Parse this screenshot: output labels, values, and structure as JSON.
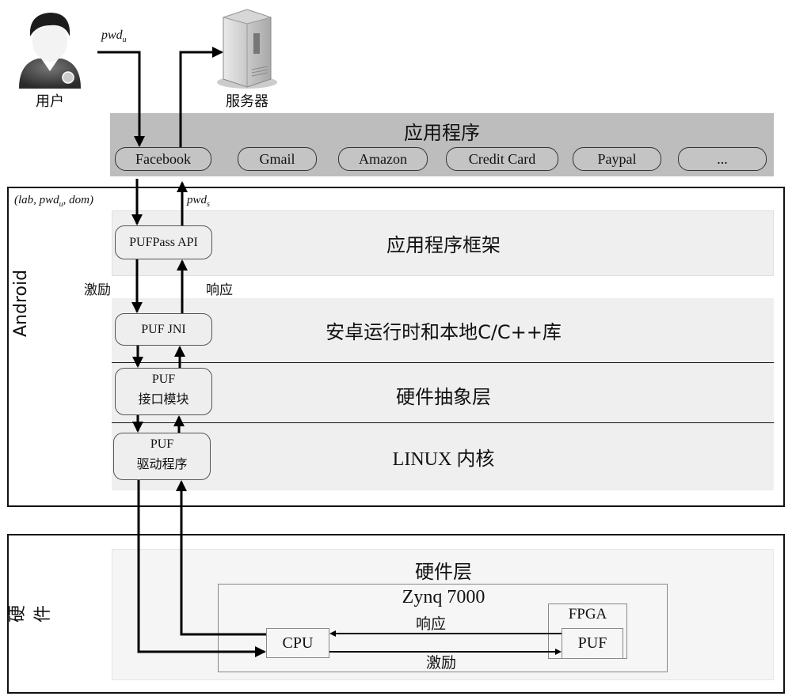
{
  "actors": {
    "user": {
      "icon": "user-avatar-icon",
      "label": "用户"
    },
    "server": {
      "icon": "server-tower-icon",
      "label": "服务器"
    }
  },
  "flows": {
    "user_to_app": {
      "label_main": "pwd",
      "label_sub": "u"
    },
    "app_to_framework": {
      "label": "(lab, pwd",
      "label_sub": "u",
      "label_tail": ", dom)"
    },
    "framework_to_app": {
      "label_main": "pwd",
      "label_sub": "s"
    },
    "challenge_label": "激励",
    "response_label": "响应"
  },
  "applications": {
    "title": "应用程序",
    "apps": [
      "Facebook",
      "Gmail",
      "Amazon",
      "Credit Card",
      "Paypal",
      "..."
    ]
  },
  "android": {
    "label": "Android",
    "layers": [
      {
        "title": "应用程序框架",
        "component": "PUFPass API"
      },
      {
        "title": "安卓运行时和本地C/C++库",
        "component": "PUF JNI"
      },
      {
        "title": "硬件抽象层",
        "component_line1": "PUF",
        "component_line2": "接口模块"
      },
      {
        "title": "LINUX 内核",
        "component_line1": "PUF",
        "component_line2": "驱动程序"
      }
    ]
  },
  "hardware": {
    "label": "硬件",
    "layer_title": "硬件层",
    "soc": "Zynq 7000",
    "cpu": "CPU",
    "fpga": "FPGA",
    "puf": "PUF",
    "response_label": "响应",
    "challenge_label": "激励"
  }
}
